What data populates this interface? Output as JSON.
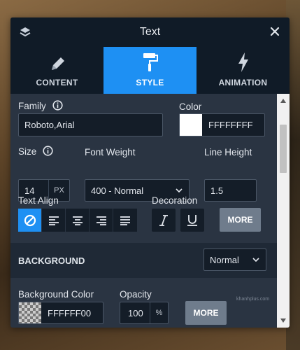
{
  "panel": {
    "title": "Text",
    "tabs": [
      {
        "label": "CONTENT",
        "icon": "pencil-icon",
        "active": false
      },
      {
        "label": "STYLE",
        "icon": "paint-roller-icon",
        "active": true
      },
      {
        "label": "ANIMATION",
        "icon": "lightning-icon",
        "active": false
      }
    ]
  },
  "style": {
    "family_label": "Family",
    "family_value": "Roboto,Arial",
    "color_label": "Color",
    "color_value": "FFFFFFFF",
    "size_label": "Size",
    "size_value": "14",
    "size_unit": "PX",
    "weight_label": "Font Weight",
    "weight_value": "400 - Normal",
    "line_height_label": "Line Height",
    "line_height_value": "1.5",
    "align_label": "Text Align",
    "decoration_label": "Decoration",
    "more_label": "MORE"
  },
  "background": {
    "section_title": "BACKGROUND",
    "mode_value": "Normal",
    "color_label": "Background Color",
    "color_value": "FFFFFF00",
    "opacity_label": "Opacity",
    "opacity_value": "100",
    "opacity_unit": "%",
    "more_label": "MORE",
    "watermark": "khanhplus.com"
  },
  "colors": {
    "accent": "#1e90f3",
    "panel_bg": "#2a3442",
    "header_bg": "#101b27",
    "field_bg": "#141d28"
  }
}
